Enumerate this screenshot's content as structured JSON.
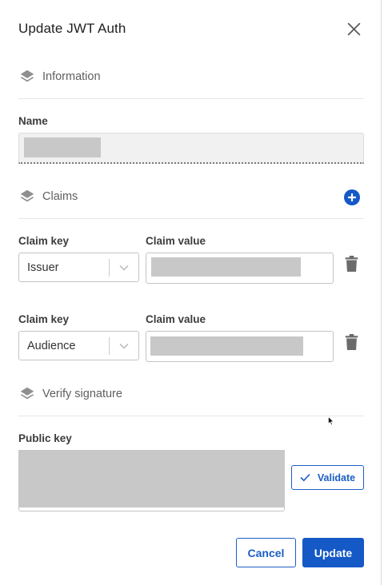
{
  "dialog": {
    "title": "Update JWT Auth",
    "close_icon": "close-icon"
  },
  "sections": {
    "information": "Information",
    "claims": "Claims",
    "verify_signature": "Verify signature"
  },
  "name": {
    "label": "Name",
    "value": ""
  },
  "claims": [
    {
      "key_label": "Claim key",
      "value_label": "Claim value",
      "key": "Issuer",
      "value": ""
    },
    {
      "key_label": "Claim key",
      "value_label": "Claim value",
      "key": "Audience",
      "value": ""
    }
  ],
  "public_key": {
    "label": "Public key",
    "value": "",
    "validate_label": "Validate"
  },
  "footer": {
    "cancel_label": "Cancel",
    "update_label": "Update"
  },
  "colors": {
    "primary": "#1559c7",
    "redacted": "#c8c8c8"
  }
}
